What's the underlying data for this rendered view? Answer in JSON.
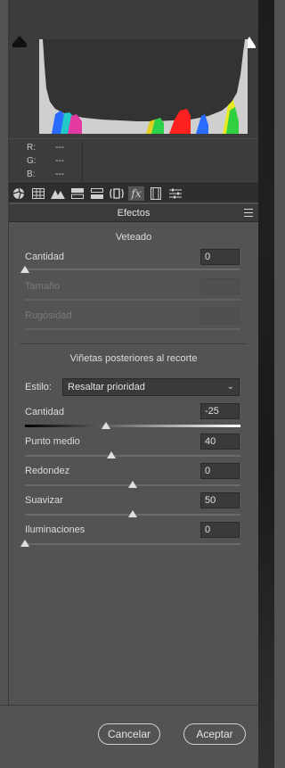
{
  "readout": {
    "r_label": "R:",
    "r_value": "---",
    "g_label": "G:",
    "g_value": "---",
    "b_label": "B:",
    "b_value": "---"
  },
  "toolbar": {
    "icons": [
      "aperture-icon",
      "grid-icon",
      "mountains-icon",
      "split-tone-icon",
      "lens-icon",
      "detail-icon",
      "fx-icon",
      "film-icon",
      "sliders-icon"
    ],
    "active": "fx-icon"
  },
  "section": {
    "title": "Efectos"
  },
  "grain": {
    "title": "Veteado",
    "amount": {
      "label": "Cantidad",
      "value": "0",
      "level": 0
    },
    "size": {
      "label": "Tamaño"
    },
    "roughness": {
      "label": "Rugosidad"
    }
  },
  "vignette": {
    "title": "Viñetas posteriores al recorte",
    "style_label": "Estilo:",
    "style_value": "Resaltar prioridad",
    "amount": {
      "label": "Cantidad",
      "value": "-25",
      "min": -100,
      "max": 100
    },
    "midpoint": {
      "label": "Punto medio",
      "value": "40",
      "min": 0,
      "max": 100
    },
    "roundness": {
      "label": "Redondez",
      "value": "0",
      "min": -100,
      "max": 100
    },
    "feather": {
      "label": "Suavizar",
      "value": "50",
      "min": 0,
      "max": 100
    },
    "highlights": {
      "label": "Iluminaciones",
      "value": "0",
      "min": 0,
      "max": 100
    }
  },
  "buttons": {
    "cancel": "Cancelar",
    "ok": "Aceptar"
  },
  "colors": {
    "panel_bg": "#535353",
    "histogram_bg": "#333333",
    "toolbar_bg": "#2e2e2e"
  }
}
